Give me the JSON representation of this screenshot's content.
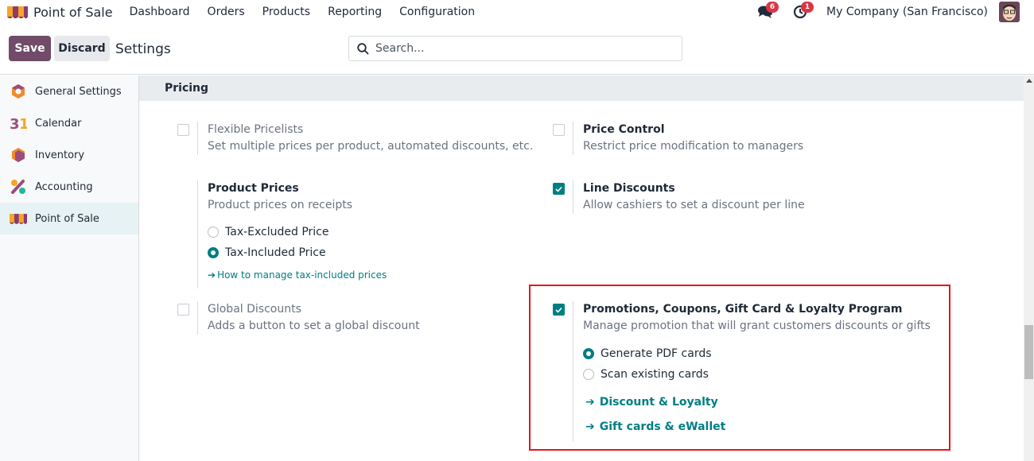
{
  "navbar": {
    "app_name": "Point of Sale",
    "menu": [
      "Dashboard",
      "Orders",
      "Products",
      "Reporting",
      "Configuration"
    ],
    "messages_count": "6",
    "activities_count": "1",
    "company": "My Company (San Francisco)"
  },
  "control_panel": {
    "save_label": "Save",
    "discard_label": "Discard",
    "title": "Settings",
    "search_placeholder": "Search..."
  },
  "sidebar": {
    "items": [
      {
        "label": "General Settings",
        "icon": "general-settings-icon"
      },
      {
        "label": "Calendar",
        "icon": "calendar-icon",
        "glyph": "31"
      },
      {
        "label": "Inventory",
        "icon": "inventory-icon"
      },
      {
        "label": "Accounting",
        "icon": "accounting-icon"
      },
      {
        "label": "Point of Sale",
        "icon": "point-of-sale-icon",
        "active": true
      }
    ]
  },
  "section": {
    "title": "Pricing",
    "settings": {
      "flexible_pricelists": {
        "title": "Flexible Pricelists",
        "desc": "Set multiple prices per product, automated discounts, etc.",
        "checked": false
      },
      "price_control": {
        "title": "Price Control",
        "desc": "Restrict price modification to managers",
        "checked": false
      },
      "product_prices": {
        "title": "Product Prices",
        "desc": "Product prices on receipts",
        "options": [
          "Tax-Excluded Price",
          "Tax-Included Price"
        ],
        "selected": "Tax-Included Price",
        "link": "How to manage tax-included prices"
      },
      "line_discounts": {
        "title": "Line Discounts",
        "desc": "Allow cashiers to set a discount per line",
        "checked": true
      },
      "global_discounts": {
        "title": "Global Discounts",
        "desc": "Adds a button to set a global discount",
        "checked": false
      },
      "promotions": {
        "title": "Promotions, Coupons, Gift Card & Loyalty Program",
        "desc": "Manage promotion that will grant customers discounts or gifts",
        "checked": true,
        "options": [
          "Generate PDF cards",
          "Scan existing cards"
        ],
        "selected": "Generate PDF cards",
        "links": [
          "Discount & Loyalty",
          "Gift cards & eWallet"
        ]
      }
    }
  },
  "colors": {
    "primary": "#714b67",
    "accent": "#017e84",
    "highlight": "#e8141b",
    "badge": "#dc3545"
  }
}
